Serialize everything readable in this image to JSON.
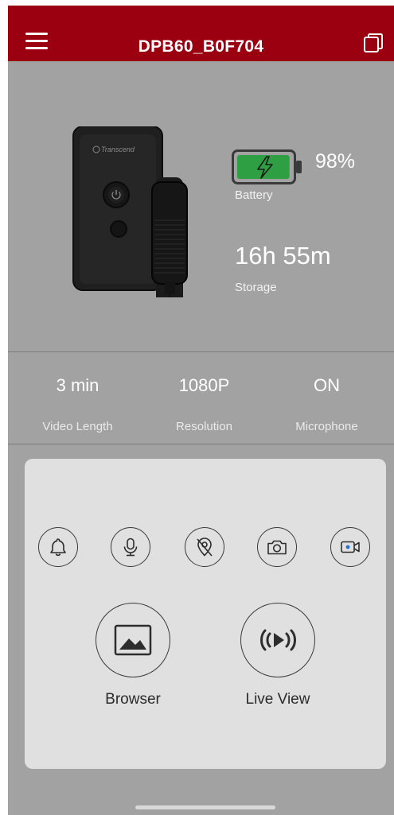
{
  "header": {
    "title": "DPB60_B0F704"
  },
  "device": {
    "brand_logo_text": "Transcend"
  },
  "battery": {
    "percent": "98%",
    "label": "Battery",
    "level": 0.98,
    "color": "#2ea043"
  },
  "storage": {
    "value": "16h 55m",
    "label": "Storage"
  },
  "stats": [
    {
      "value": "3 min",
      "label": "Video Length"
    },
    {
      "value": "1080P",
      "label": "Resolution"
    },
    {
      "value": "ON",
      "label": "Microphone"
    }
  ],
  "quick_actions": [
    {
      "icon": "bell-icon"
    },
    {
      "icon": "microphone-icon"
    },
    {
      "icon": "location-off-icon"
    },
    {
      "icon": "camera-icon"
    },
    {
      "icon": "video-record-icon"
    }
  ],
  "actions": {
    "browser_label": "Browser",
    "live_view_label": "Live View"
  },
  "colors": {
    "header": "#9b0011",
    "background": "#a2a2a2",
    "card": "#e0e0e0",
    "accent": "#1f6fd6"
  }
}
